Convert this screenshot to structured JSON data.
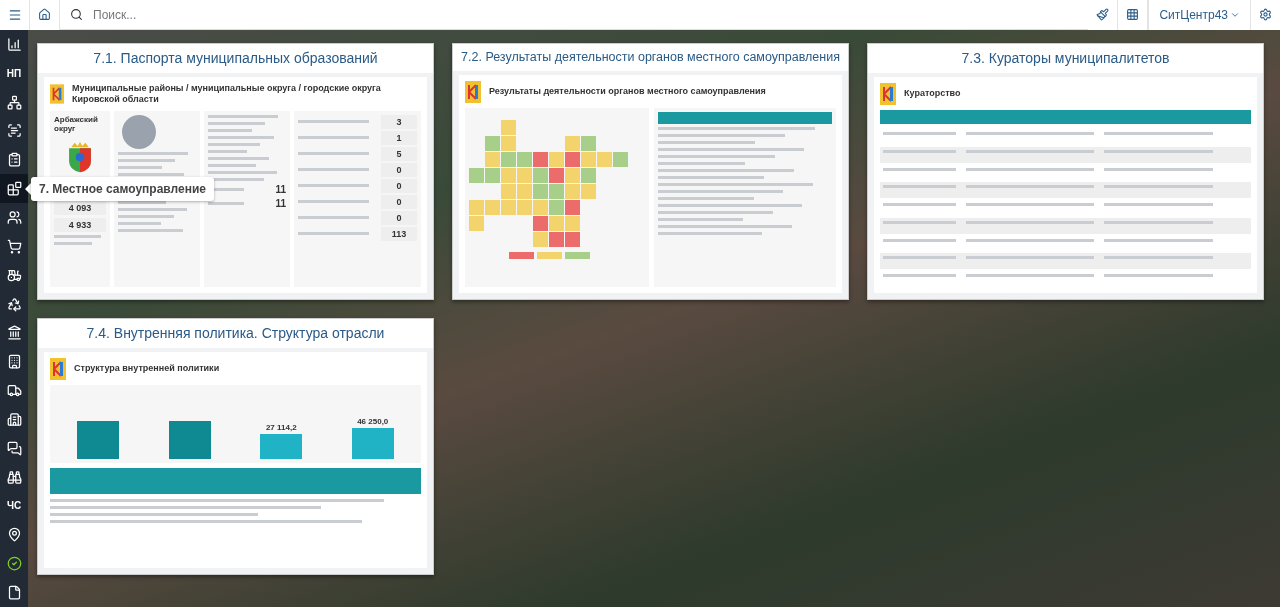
{
  "top_bar": {
    "search": {
      "placeholder": "Поиск..."
    },
    "user_menu": "СитЦентр43"
  },
  "sidebar": {
    "items": [
      {
        "selected": false
      },
      {
        "label": "НП",
        "selected": false
      },
      {
        "selected": false
      },
      {
        "selected": false
      },
      {
        "selected": false
      },
      {
        "selected": true
      },
      {
        "selected": false
      },
      {
        "selected": false
      },
      {
        "selected": false
      },
      {
        "selected": false
      },
      {
        "selected": false
      },
      {
        "selected": false
      },
      {
        "selected": false
      },
      {
        "selected": false
      },
      {
        "selected": false
      },
      {
        "selected": false
      },
      {
        "label": "ЧС",
        "selected": false
      },
      {
        "selected": false
      },
      {
        "selected": false
      },
      {
        "selected": false
      }
    ],
    "tooltip": "7. Местное самоуправление"
  },
  "cards": [
    {
      "kind": "passport",
      "title": "7.1. Паспорта муниципальных образований",
      "heading": "Муниципальные районы / муниципальные округа / городские округа Кировской области",
      "district": "Арбажский округ",
      "population": [
        "4 093",
        "4 933"
      ],
      "deputies": [
        "11",
        "11"
      ],
      "stats": [
        "3",
        "1",
        "5",
        "0",
        "0",
        "0",
        "0",
        "113"
      ]
    },
    {
      "kind": "results",
      "title": "7.2. Результаты деятельности органов местного самоуправления",
      "heading": "Результаты деятельности органов местного самоуправления"
    },
    {
      "kind": "curators",
      "title": "7.3. Кураторы муниципалитетов",
      "heading": "Кураторство"
    },
    {
      "kind": "policy",
      "title": "7.4. Внутренняя политика. Структура отрасли",
      "heading": "Структура внутренней политики",
      "bar_labels": [
        "27 114,2",
        "46 250,0"
      ]
    }
  ]
}
